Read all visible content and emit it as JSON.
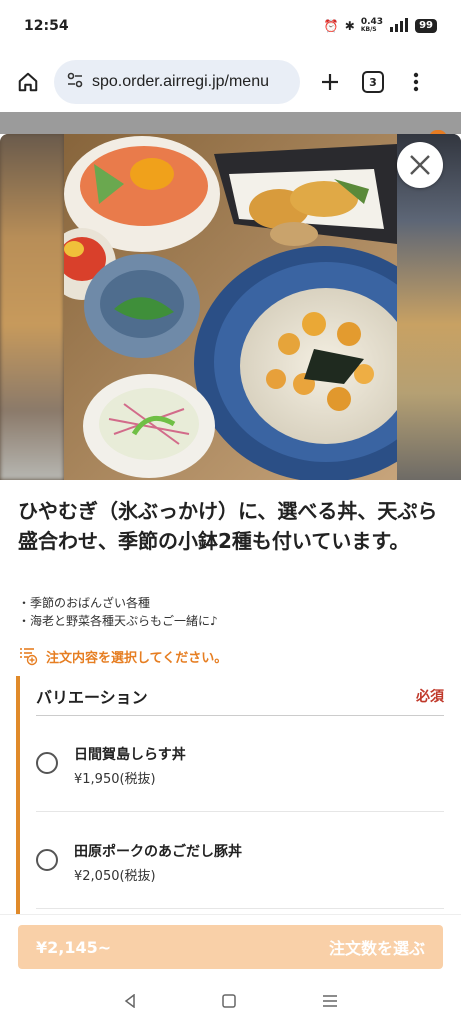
{
  "status_bar": {
    "time": "12:54",
    "net_speed": "0.43",
    "net_unit": "KB/S",
    "battery": "99"
  },
  "browser": {
    "url": "spo.order.airregi.jp/menu",
    "tab_count": "3"
  },
  "item": {
    "title": "ひやむぎ（氷ぶっかけ）に、選べる丼、天ぷら盛合わせ、季節の小鉢2種も付いています。",
    "notes": [
      "・季節のおばんざい各種",
      "・海老と野菜各種天ぷらもご一緒に♪"
    ]
  },
  "instruction": "注文内容を選択してください。",
  "variation": {
    "title": "バリエーション",
    "required_label": "必須",
    "options": [
      {
        "name": "日間賀島しらす丼",
        "price": "¥1,950(税抜)"
      },
      {
        "name": "田原ポークのあごだし豚丼",
        "price": "¥2,050(税抜)"
      }
    ]
  },
  "footer": {
    "price": "¥2,145~",
    "action_label": "注文数を選ぶ"
  },
  "colors": {
    "accent": "#e67e22",
    "required": "#c0392b",
    "button_disabled": "#f9d0a8"
  }
}
